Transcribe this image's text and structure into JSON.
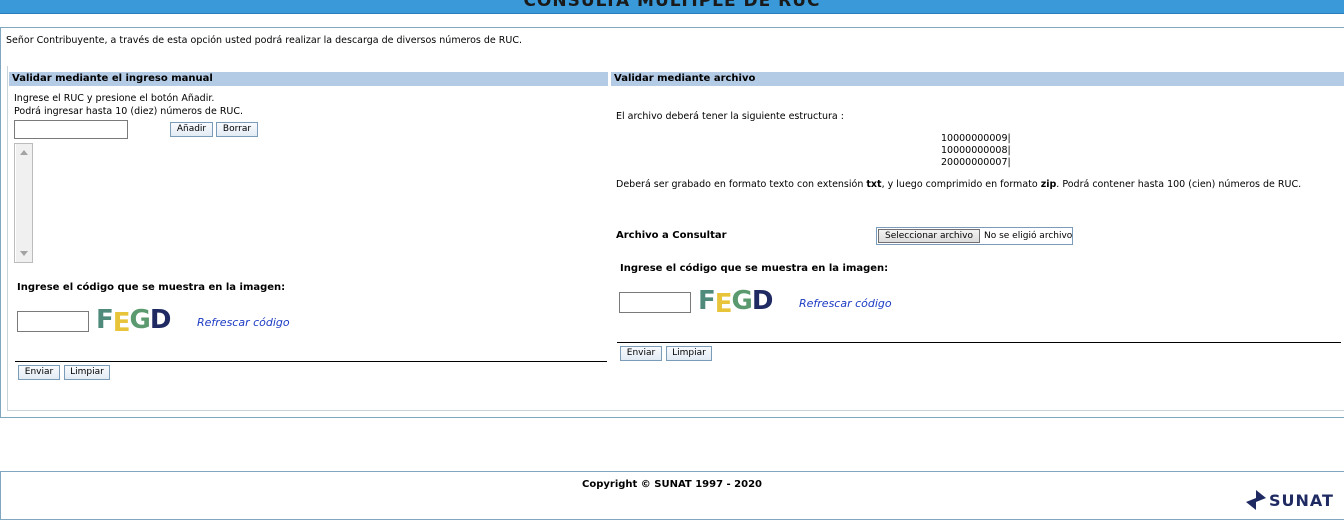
{
  "page": {
    "title": "CONSULTA MÚLTIPLE DE RUC",
    "intro": "Señor Contribuyente, a través de esta opción usted podrá realizar la descarga de diversos números de RUC."
  },
  "manual": {
    "header": "Validar mediante el ingreso manual",
    "instruction1": "Ingrese el RUC y presione el botón Añadir.",
    "instruction2": "Podrá ingresar hasta 10 (diez) números de RUC.",
    "ruc_value": "",
    "add_label": "Añadir",
    "clear_label": "Borrar",
    "captcha_prompt": "Ingrese el código que se muestra en la imagen:",
    "captcha_value": "",
    "captcha_code": [
      "F",
      "E",
      "G",
      "D"
    ],
    "refresh_label": "Refrescar código",
    "send_label": "Enviar",
    "reset_label": "Limpiar"
  },
  "file": {
    "header": "Validar mediante archivo",
    "structure_text": "El archivo deberá tener la siguiente estructura :",
    "sample_lines": [
      "10000000009|",
      "10000000008|",
      "20000000007|"
    ],
    "format_pre": "Deberá ser grabado en formato texto con extensión ",
    "format_ext": "txt",
    "format_mid": ", y luego comprimido en formato ",
    "format_zip": "zip",
    "format_post": ". Podrá contener hasta 100 (cien) números de RUC.",
    "file_label": "Archivo a Consultar",
    "choose_label": "Seleccionar archivo",
    "no_file_label": "No se eligió archivo",
    "captcha_prompt": "Ingrese el código que se muestra en la imagen:",
    "captcha_value": "",
    "captcha_code": [
      "F",
      "E",
      "G",
      "D"
    ],
    "refresh_label": "Refrescar código",
    "send_label": "Enviar",
    "reset_label": "Limpiar"
  },
  "footer": {
    "copyright": "Copyright © SUNAT 1997 - 2020",
    "logo_text": "SUNAT",
    "logo_icon": "sunat-logo-icon"
  },
  "colors": {
    "title_bar": "#3a9ad9",
    "section_header": "#b4cbe6",
    "link": "#1c3bc4",
    "captcha_f": "#4f8a7b",
    "captcha_e": "#e8c43a",
    "captcha_g": "#5a9a6e",
    "captcha_d": "#1f2a63",
    "logo": "#1f2a63"
  }
}
